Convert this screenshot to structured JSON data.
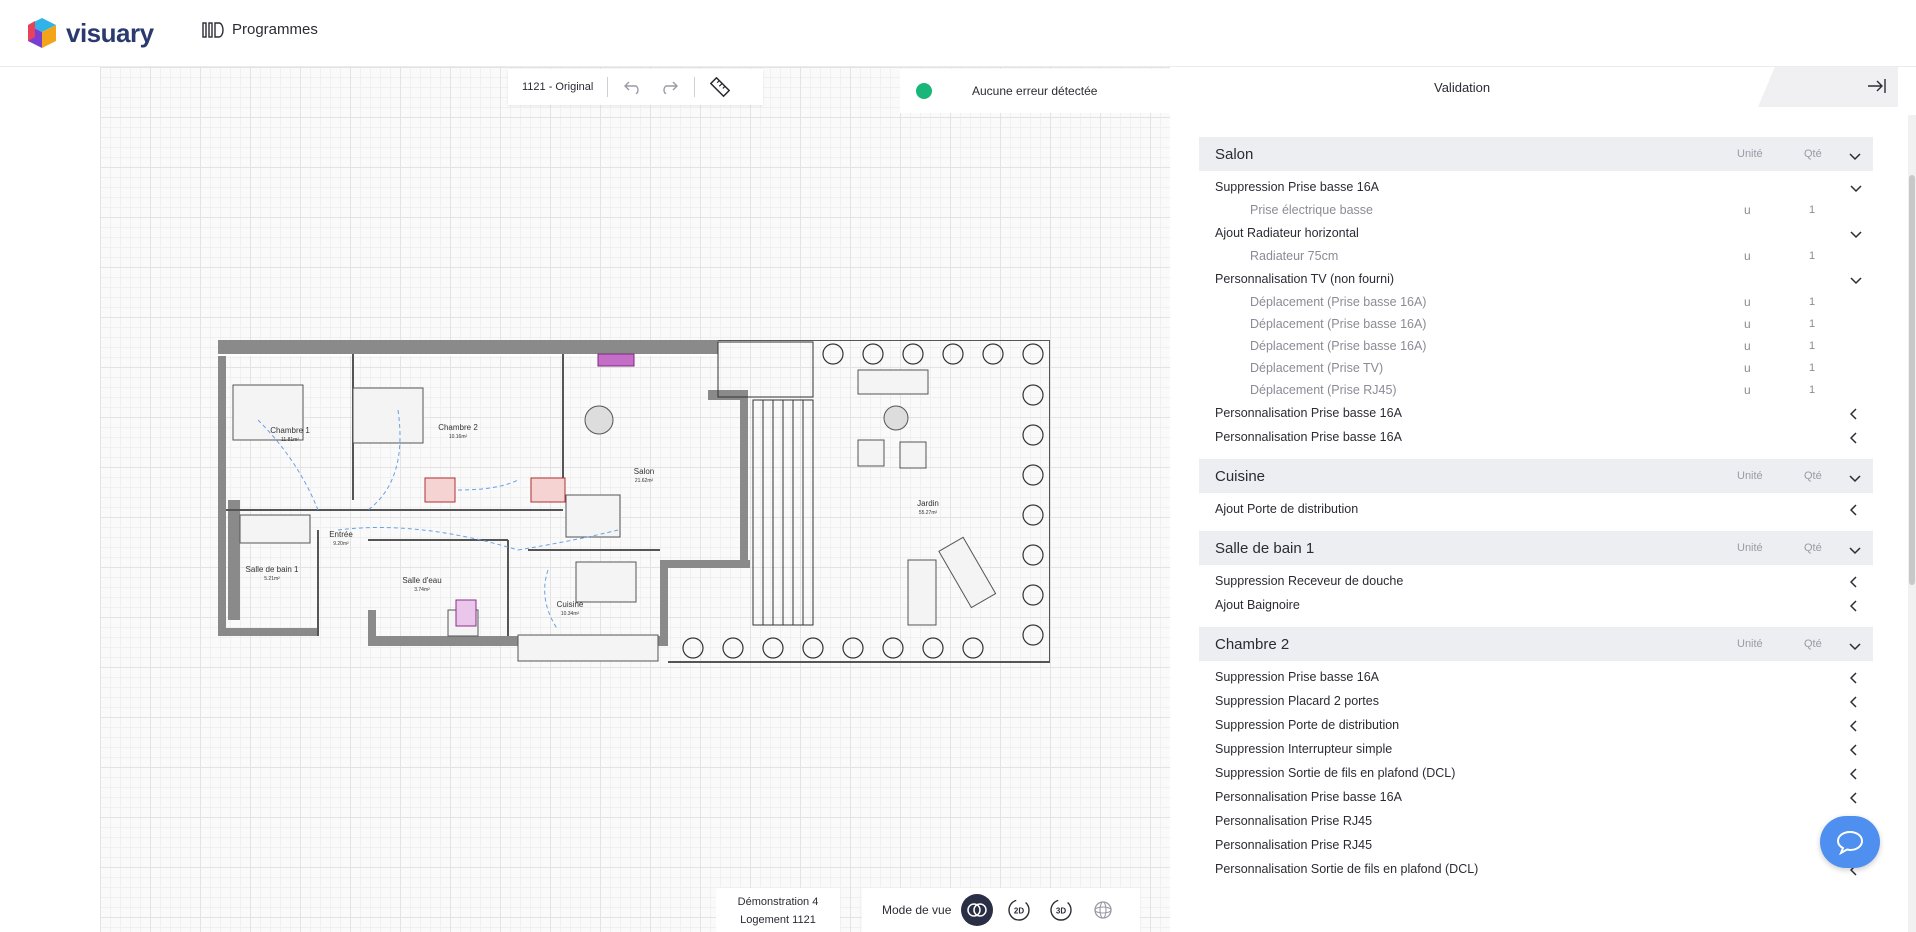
{
  "app": {
    "logo_text": "visuary",
    "nav_programmes": "Programmes"
  },
  "toolbar": {
    "version_label": "1121 - Original"
  },
  "status": {
    "message": "Aucune erreur détectée",
    "color": "#19b67a"
  },
  "plan_labels": {
    "chambre1": "Chambre 1",
    "chambre1_area": "11.81m²",
    "chambre2": "Chambre 2",
    "chambre2_area": "10.16m²",
    "salon": "Salon",
    "salon_area": "21.62m²",
    "entree": "Entrée",
    "entree_area": "9.20m²",
    "sdb": "Salle de bain 1",
    "sdb_area": "5.21m²",
    "salle_eau": "Salle d'eau",
    "salle_eau_area": "3.74m²",
    "cuisine": "Cuisine",
    "cuisine_area": "10.34m²",
    "jardin": "Jardin",
    "jardin_area": "55.27m²"
  },
  "info": {
    "line1": "Démonstration 4",
    "line2": "Logement 1121"
  },
  "view_mode": {
    "label": "Mode de vue",
    "btn_2d": "2D",
    "btn_3d": "3D"
  },
  "panel": {
    "title": "Validation",
    "col_unit": "Unité",
    "col_qty": "Qté",
    "sections": [
      {
        "name": "Salon",
        "items": [
          {
            "label": "Suppression Prise basse 16A",
            "expanded": true,
            "subs": [
              {
                "label": "Prise électrique basse",
                "unit": "u",
                "qty": "1"
              }
            ]
          },
          {
            "label": "Ajout Radiateur horizontal",
            "expanded": true,
            "subs": [
              {
                "label": "Radiateur 75cm",
                "unit": "u",
                "qty": "1"
              }
            ]
          },
          {
            "label": "Personnalisation TV (non fourni)",
            "expanded": true,
            "subs": [
              {
                "label": "Déplacement (Prise basse 16A)",
                "unit": "u",
                "qty": "1"
              },
              {
                "label": "Déplacement (Prise basse 16A)",
                "unit": "u",
                "qty": "1"
              },
              {
                "label": "Déplacement (Prise basse 16A)",
                "unit": "u",
                "qty": "1"
              },
              {
                "label": "Déplacement (Prise TV)",
                "unit": "u",
                "qty": "1"
              },
              {
                "label": "Déplacement (Prise RJ45)",
                "unit": "u",
                "qty": "1"
              }
            ]
          },
          {
            "label": "Personnalisation Prise basse 16A",
            "expanded": false,
            "subs": []
          },
          {
            "label": "Personnalisation Prise basse 16A",
            "expanded": false,
            "subs": []
          }
        ]
      },
      {
        "name": "Cuisine",
        "items": [
          {
            "label": "Ajout Porte de distribution",
            "expanded": false,
            "subs": []
          }
        ]
      },
      {
        "name": "Salle de bain 1",
        "items": [
          {
            "label": "Suppression Receveur de douche",
            "expanded": false,
            "subs": []
          },
          {
            "label": "Ajout Baignoire",
            "expanded": false,
            "subs": []
          }
        ]
      },
      {
        "name": "Chambre 2",
        "items": [
          {
            "label": "Suppression Prise basse 16A",
            "expanded": false,
            "subs": []
          },
          {
            "label": "Suppression Placard 2 portes",
            "expanded": false,
            "subs": []
          },
          {
            "label": "Suppression Porte de distribution",
            "expanded": false,
            "subs": []
          },
          {
            "label": "Suppression Interrupteur simple",
            "expanded": false,
            "subs": []
          },
          {
            "label": "Suppression Sortie de fils en plafond (DCL)",
            "expanded": false,
            "subs": []
          },
          {
            "label": "Personnalisation Prise basse 16A",
            "expanded": false,
            "subs": []
          },
          {
            "label": "Personnalisation Prise RJ45",
            "expanded": false,
            "subs": []
          },
          {
            "label": "Personnalisation Prise RJ45",
            "expanded": false,
            "subs": []
          },
          {
            "label": "Personnalisation Sortie de fils en plafond (DCL)",
            "expanded": false,
            "subs": []
          }
        ]
      }
    ]
  }
}
